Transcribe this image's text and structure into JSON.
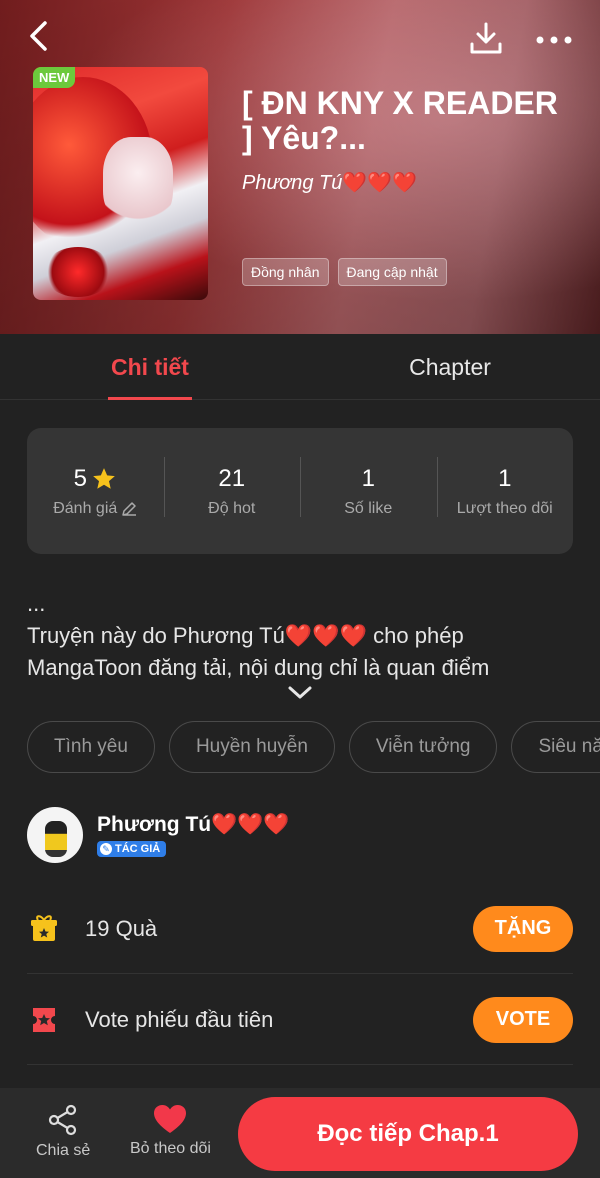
{
  "header": {
    "new_badge": "NEW",
    "title": "[ ĐN KNY X READER ] Yêu?...",
    "author": "Phương Tú",
    "author_hearts": "❤️❤️❤️",
    "tags": [
      "Đồng nhân",
      "Đang cập nhật"
    ]
  },
  "tabs": [
    {
      "label": "Chi tiết",
      "active": true
    },
    {
      "label": "Chapter",
      "active": false
    }
  ],
  "stats": [
    {
      "value": "5",
      "label": "Đánh giá"
    },
    {
      "value": "21",
      "label": "Độ hot"
    },
    {
      "value": "1",
      "label": "Số like"
    },
    {
      "value": "1",
      "label": "Lượt theo dõi"
    }
  ],
  "description": {
    "line1": "...",
    "line2_a": "Truyện này do Phương Tú",
    "line2_hearts": "❤️❤️❤️",
    "line2_b": " cho phép",
    "line3": "MangaToon đăng tải, nội dung chỉ là quan điểm"
  },
  "genres": [
    "Tình yêu",
    "Huyền huyễn",
    "Viễn tưởng",
    "Siêu nă"
  ],
  "author_block": {
    "name": "Phương Tú",
    "hearts": "❤️❤️❤️",
    "badge": "TÁC GIẢ"
  },
  "gift": {
    "text": "19  Quà",
    "button": "TẶNG"
  },
  "vote": {
    "text": "Vote phiếu đầu tiên",
    "button": "VOTE"
  },
  "bottom_bar": {
    "share_label": "Chia sẻ",
    "follow_label": "Bỏ theo dõi",
    "read_label": "Đọc tiếp Chap.1"
  },
  "colors": {
    "accent": "#f2484d",
    "vote_button": "#ff8a1c",
    "read_button": "#f53b43",
    "background": "#222222"
  }
}
